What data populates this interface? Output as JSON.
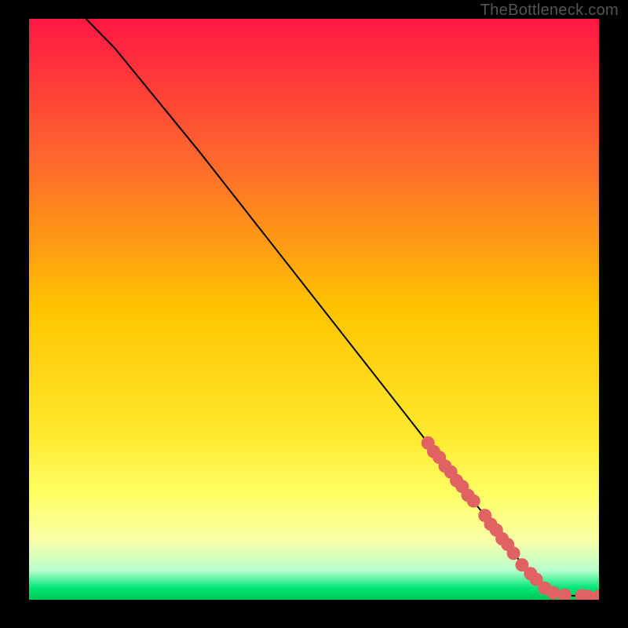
{
  "attribution": "TheBottleneck.com",
  "chart_data": {
    "type": "line",
    "title": "",
    "xlabel": "",
    "ylabel": "",
    "xlim": [
      0,
      100
    ],
    "ylim": [
      0,
      100
    ],
    "grid": false,
    "legend": false,
    "background_gradient": {
      "stops": [
        {
          "offset": 0,
          "color": "#ff1744"
        },
        {
          "offset": 25,
          "color": "#ff6a2c"
        },
        {
          "offset": 50,
          "color": "#ffc400"
        },
        {
          "offset": 72,
          "color": "#ffe92e"
        },
        {
          "offset": 82,
          "color": "#ffff66"
        },
        {
          "offset": 90,
          "color": "#f7ffa8"
        },
        {
          "offset": 95,
          "color": "#b6ffcd"
        },
        {
          "offset": 98,
          "color": "#00e676"
        },
        {
          "offset": 100,
          "color": "#00c853"
        }
      ]
    },
    "series": [
      {
        "name": "curve",
        "type": "line",
        "color": "#000000",
        "x": [
          10,
          12,
          15,
          20,
          30,
          40,
          50,
          60,
          70,
          75,
          80,
          85,
          88,
          90,
          92,
          95,
          98,
          100
        ],
        "y": [
          100,
          98,
          95,
          89,
          77,
          64.5,
          52,
          39.5,
          27,
          20.5,
          14.5,
          8,
          4.5,
          2.5,
          1.2,
          0.7,
          0.6,
          0.6
        ]
      },
      {
        "name": "markers",
        "type": "scatter",
        "color": "#e06262",
        "x": [
          70,
          71,
          72,
          73,
          74,
          75,
          76,
          77,
          78,
          80,
          81,
          82,
          83,
          84,
          85,
          86.5,
          88,
          89,
          90.5,
          92,
          94,
          97,
          98,
          100
        ],
        "y": [
          27,
          25.5,
          24.5,
          23,
          22,
          20.5,
          19.5,
          18,
          17,
          14.5,
          13,
          12,
          10.5,
          9.5,
          8,
          6,
          4.5,
          3.5,
          2,
          1.2,
          0.8,
          0.7,
          0.6,
          0.6
        ]
      }
    ]
  }
}
